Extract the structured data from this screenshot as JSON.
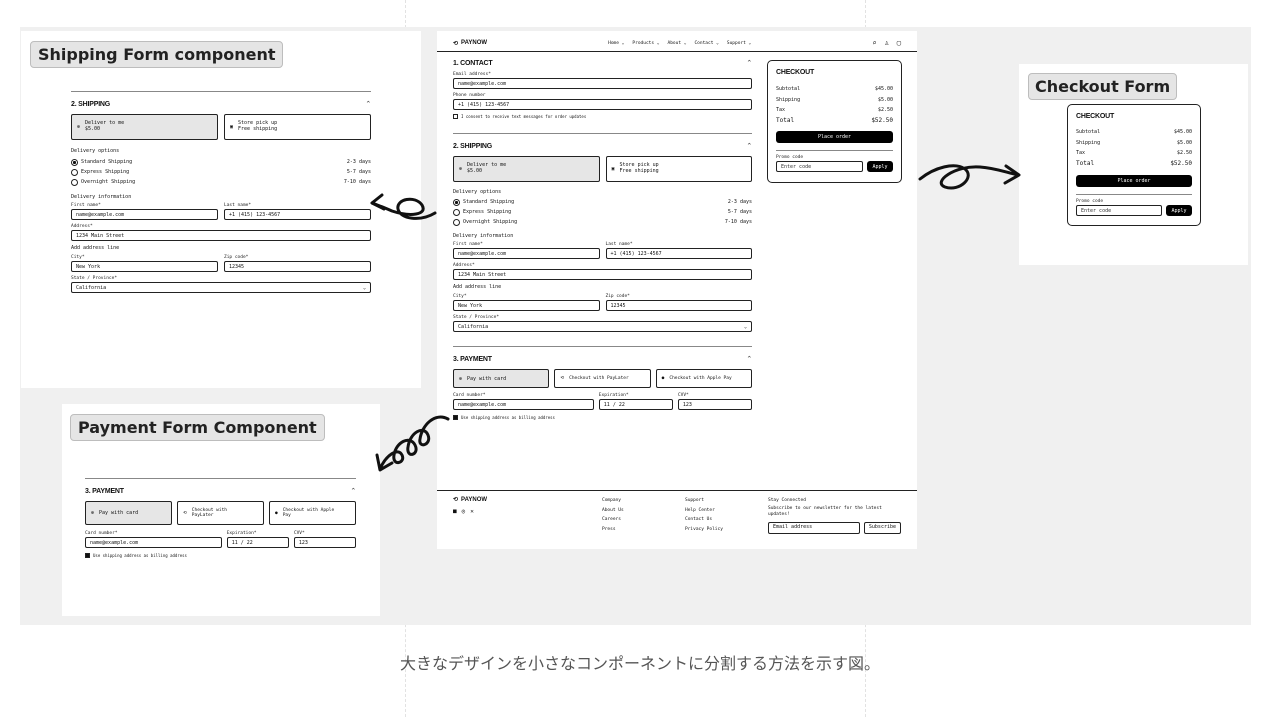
{
  "caption": "大きなデザインを小さなコンポーネントに分割する方法を示す図。",
  "tags": {
    "shipping": "Shipping Form component",
    "checkout": "Checkout Form",
    "payment": "Payment Form Component"
  },
  "nav": {
    "brand": "PAYNOW",
    "items": [
      "Home ⌄",
      "Products ⌄",
      "About ⌄",
      "Contact ⌄",
      "Support ⌄"
    ]
  },
  "contact": {
    "title": "1. CONTACT",
    "email_label": "Email address*",
    "email_value": "name@example.com",
    "phone_label": "Phone number",
    "phone_value": "+1 (415) 123-4567",
    "consent": "I consent to receive text messages for order updates"
  },
  "shipping": {
    "title": "2. SHIPPING",
    "deliver_title": "Deliver to me",
    "deliver_price": "$5.00",
    "pickup_title": "Store pick up",
    "pickup_price": "Free shipping",
    "options_label": "Delivery options",
    "options": [
      {
        "name": "Standard Shipping",
        "days": "2-3 days"
      },
      {
        "name": "Express Shipping",
        "days": "5-7 days"
      },
      {
        "name": "Overnight Shipping",
        "days": "7-10 days"
      }
    ],
    "info_label": "Delivery information",
    "first_label": "First name*",
    "first_value": "name@example.com",
    "last_label": "Last name*",
    "last_value": "+1 (415) 123-4567",
    "address_label": "Address*",
    "address_value": "1234 Main Street",
    "add_line": "Add address line",
    "city_label": "City*",
    "city_value": "New York",
    "zip_label": "Zip code*",
    "zip_value": "12345",
    "state_label": "State / Province*",
    "state_value": "California"
  },
  "payment": {
    "title": "3. PAYMENT",
    "card_btn": "Pay with card",
    "paylater_btn": "Checkout with PayLater",
    "applepay_btn": "Checkout with Apple Pay",
    "paylater_small_1": "Checkout with",
    "paylater_small_2": "PayLater",
    "applepay_small_1": "Checkout with Apple",
    "applepay_small_2": "Pay",
    "card_label": "Card number*",
    "card_value": "name@example.com",
    "exp_label": "Expiration*",
    "exp_value": "11 / 22",
    "cvv_label": "CVV*",
    "cvv_value": "123",
    "billing": "Use shipping address as billing address"
  },
  "checkout": {
    "title": "CHECKOUT",
    "subtotal_label": "Subtotal",
    "subtotal": "$45.00",
    "shipping_label": "Shipping",
    "shipping": "$5.00",
    "tax_label": "Tax",
    "tax": "$2.50",
    "total_label": "Total",
    "total": "$52.50",
    "place_order": "Place order",
    "promo_label": "Promo code",
    "promo_placeholder": "Enter code",
    "apply": "Apply"
  },
  "footer": {
    "brand": "PAYNOW",
    "col1": [
      "Company",
      "About Us",
      "Careers",
      "Press"
    ],
    "col2": [
      "Support",
      "Help Center",
      "Contact Us",
      "Privacy Policy"
    ],
    "stay_title": "Stay Connected",
    "stay_text": "Subscribe to our newsletter for the latest updates!",
    "email_placeholder": "Email address",
    "subscribe": "Subscribe"
  }
}
